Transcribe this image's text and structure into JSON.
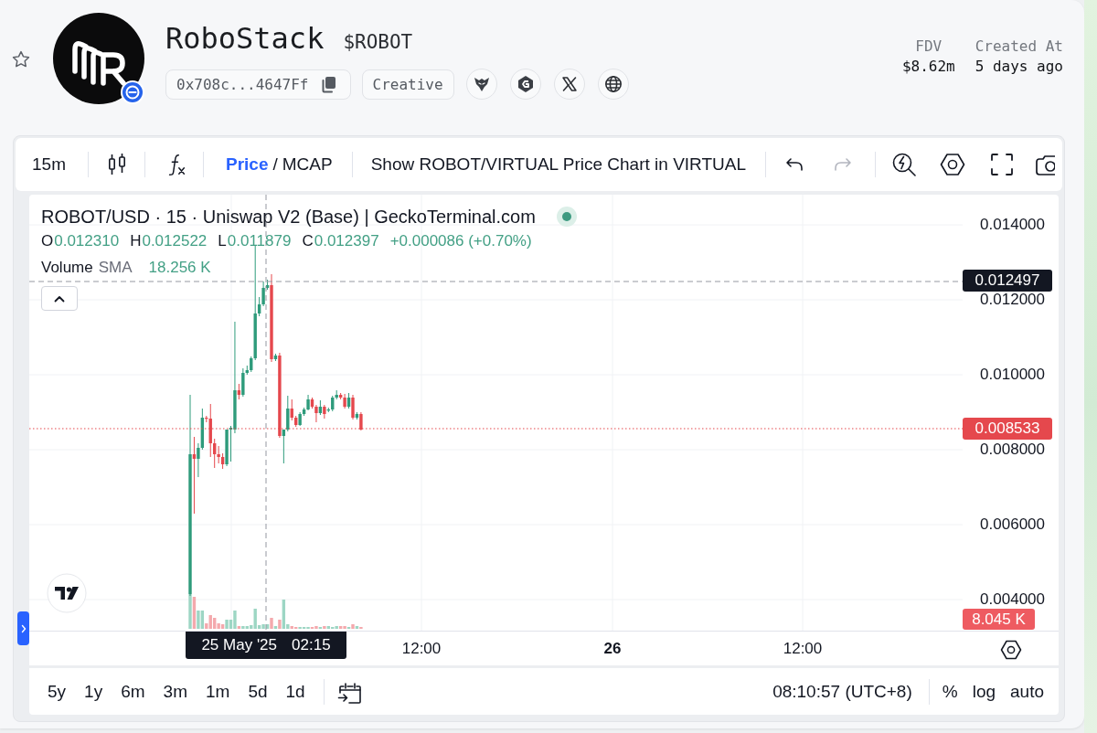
{
  "header": {
    "starred": false,
    "token": {
      "name": "RoboStack",
      "ticker": "$ROBOT",
      "address": "0x708c...4647Ff",
      "category": "Creative"
    },
    "stats": [
      {
        "label": "FDV",
        "value": "$8.62m"
      },
      {
        "label": "Created At",
        "value": "5 days ago"
      }
    ]
  },
  "toolbar": {
    "interval": "15m",
    "price_modes": [
      {
        "label": "Price",
        "selected": true
      },
      {
        "label": "MCAP",
        "selected": false
      }
    ],
    "mode_separator": "/",
    "compare_button": "Show ROBOT/VIRTUAL Price Chart in VIRTUAL",
    "undo": {
      "disabled": false
    },
    "redo": {
      "disabled": true
    }
  },
  "chart": {
    "legend": {
      "title": "ROBOT/USD · 15 · Uniswap V2 (Base) | GeckoTerminal.com",
      "ohlc": [
        {
          "key": "O",
          "value": "0.012310"
        },
        {
          "key": "H",
          "value": "0.012522"
        },
        {
          "key": "L",
          "value": "0.011879"
        },
        {
          "key": "C",
          "value": "0.012397"
        }
      ],
      "change": "+0.000086 (+0.70%)",
      "volume": {
        "label": "Volume",
        "indicator": "SMA",
        "value": "18.256 K"
      }
    },
    "price_axis": [
      "0.014000",
      "0.012000",
      "0.010000",
      "0.008000",
      "0.006000",
      "0.004000"
    ],
    "crosshair_price": "0.012497",
    "last_price": "0.008533",
    "last_volume": "8.045 K",
    "time_axis": [
      {
        "label": "12:00",
        "kind": "time"
      },
      {
        "label": "26",
        "kind": "day"
      },
      {
        "label": "12:00",
        "kind": "time"
      }
    ],
    "crosshair_time": {
      "date": "25 May '25",
      "time": "02:15"
    }
  },
  "bottom_bar": {
    "ranges": [
      {
        "label": "5y",
        "selected": false
      },
      {
        "label": "1y",
        "selected": false
      },
      {
        "label": "6m",
        "selected": false
      },
      {
        "label": "3m",
        "selected": false
      },
      {
        "label": "1m",
        "selected": false
      },
      {
        "label": "5d",
        "selected": false
      },
      {
        "label": "1d",
        "selected": false
      }
    ],
    "clock": "08:10:57 (UTC+8)",
    "scale_options": [
      {
        "label": "%",
        "on": false
      },
      {
        "label": "log",
        "on": false
      },
      {
        "label": "auto",
        "on": false
      }
    ]
  }
}
